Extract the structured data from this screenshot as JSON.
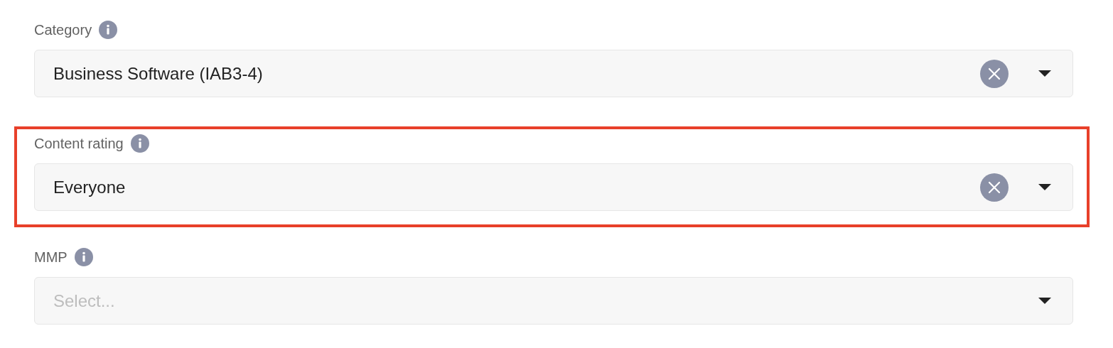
{
  "fields": [
    {
      "label": "Category",
      "value": "Business Software (IAB3-4)",
      "highlighted": false
    },
    {
      "label": "Content rating",
      "value": "Everyone",
      "highlighted": true
    },
    {
      "label": "MMP",
      "placeholder": "Select...",
      "highlighted": false
    }
  ]
}
